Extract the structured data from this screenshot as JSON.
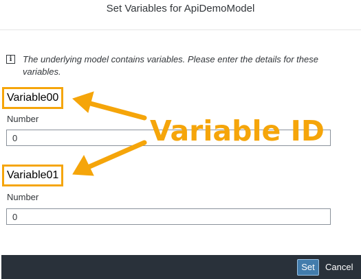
{
  "dialog": {
    "title": "Set Variables for ApiDemoModel",
    "info_text": "The underlying model contains variables. Please enter the details for these variables."
  },
  "variables": [
    {
      "id": "Variable00",
      "type_label": "Number",
      "value": "0"
    },
    {
      "id": "Variable01",
      "type_label": "Number",
      "value": "0"
    }
  ],
  "annotation": {
    "label": "Variable ID",
    "color": "#f5a50a"
  },
  "footer": {
    "set_label": "Set",
    "cancel_label": "Cancel"
  }
}
